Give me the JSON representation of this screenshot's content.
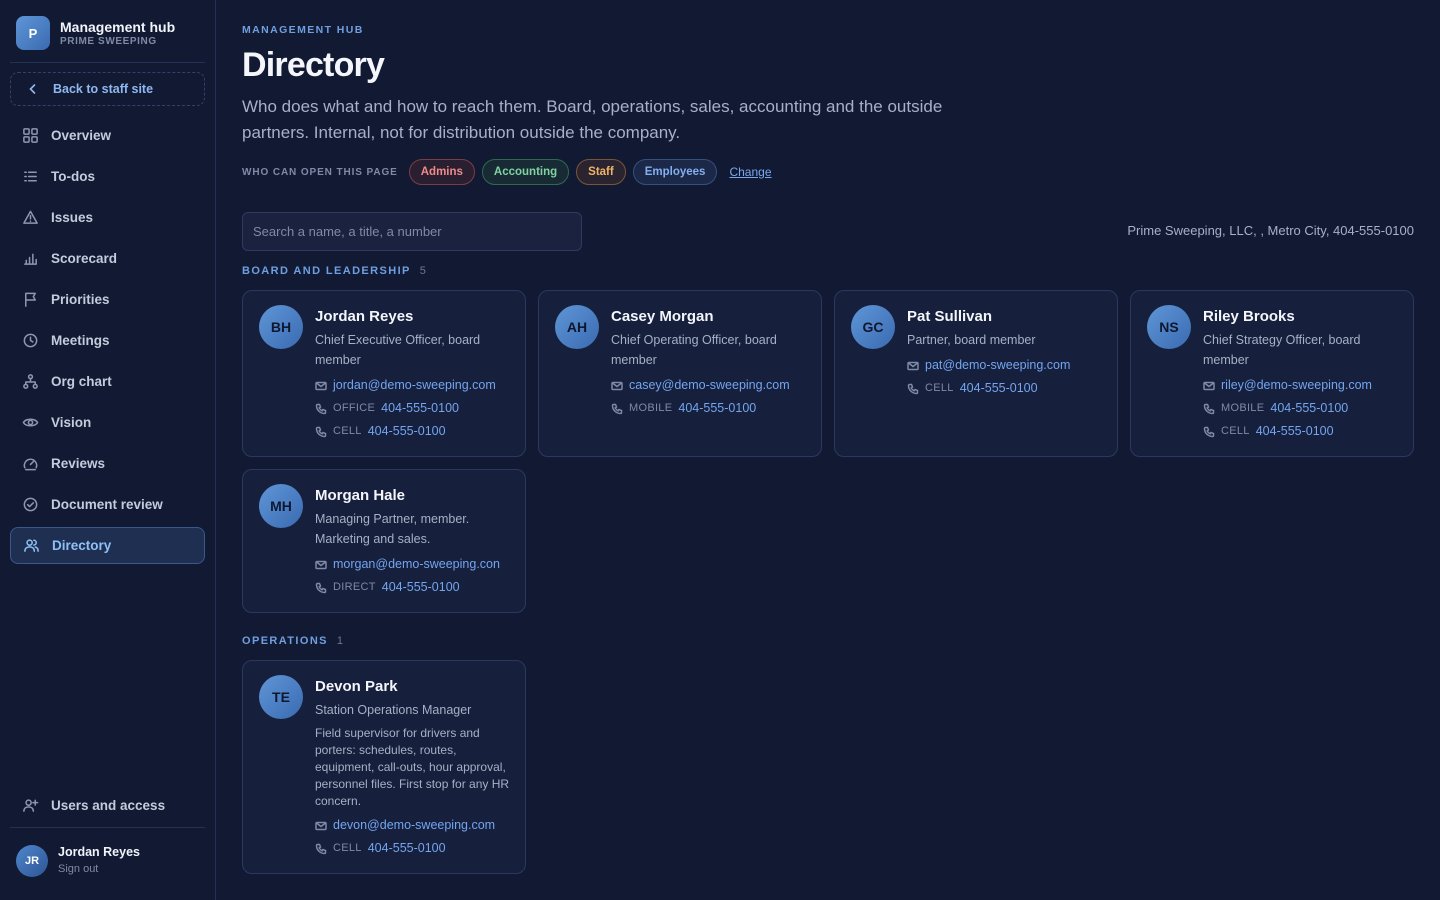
{
  "brand": {
    "logo_letter": "P",
    "title": "Management hub",
    "subtitle": "PRIME SWEEPING"
  },
  "sidebar": {
    "back_label": "Back to staff site",
    "items": [
      {
        "label": "Overview",
        "icon": "grid-icon"
      },
      {
        "label": "To-dos",
        "icon": "list-check-icon"
      },
      {
        "label": "Issues",
        "icon": "warning-icon"
      },
      {
        "label": "Scorecard",
        "icon": "bar-chart-icon"
      },
      {
        "label": "Priorities",
        "icon": "flag-icon"
      },
      {
        "label": "Meetings",
        "icon": "clock-icon"
      },
      {
        "label": "Org chart",
        "icon": "org-chart-icon"
      },
      {
        "label": "Vision",
        "icon": "eye-icon"
      },
      {
        "label": "Reviews",
        "icon": "gauge-icon"
      },
      {
        "label": "Document review",
        "icon": "check-circle-icon"
      },
      {
        "label": "Directory",
        "icon": "users-icon",
        "active": true
      }
    ],
    "users_access_label": "Users and access",
    "user": {
      "initials": "JR",
      "name": "Jordan Reyes",
      "sign_out": "Sign out"
    }
  },
  "header": {
    "eyebrow": "MANAGEMENT HUB",
    "title": "Directory",
    "description": "Who does what and how to reach them. Board, operations, sales, accounting and the outside partners. Internal, not for distribution outside the company."
  },
  "access": {
    "label": "WHO CAN OPEN THIS PAGE",
    "chips": [
      "Admins",
      "Accounting",
      "Staff",
      "Employees"
    ],
    "change_label": "Change"
  },
  "search": {
    "placeholder": "Search a name, a title, a number"
  },
  "company_info": "Prime Sweeping, LLC, , Metro City, 404-555-0100",
  "sections": [
    {
      "title": "BOARD AND LEADERSHIP",
      "count": "5",
      "people": [
        {
          "initials": "BH",
          "name": "Jordan Reyes",
          "role": "Chief Executive Officer, board member",
          "email": "jordan@demo-sweeping.com",
          "phones": [
            {
              "label": "OFFICE",
              "number": "404-555-0100"
            },
            {
              "label": "CELL",
              "number": "404-555-0100"
            }
          ]
        },
        {
          "initials": "AH",
          "name": "Casey Morgan",
          "role": "Chief Operating Officer, board member",
          "email": "casey@demo-sweeping.com",
          "phones": [
            {
              "label": "MOBILE",
              "number": "404-555-0100"
            }
          ]
        },
        {
          "initials": "GC",
          "name": "Pat Sullivan",
          "role": "Partner, board member",
          "email": "pat@demo-sweeping.com",
          "phones": [
            {
              "label": "CELL",
              "number": "404-555-0100"
            }
          ]
        },
        {
          "initials": "NS",
          "name": "Riley Brooks",
          "role": "Chief Strategy Officer, board member",
          "email": "riley@demo-sweeping.com",
          "phones": [
            {
              "label": "MOBILE",
              "number": "404-555-0100"
            },
            {
              "label": "CELL",
              "number": "404-555-0100"
            }
          ]
        },
        {
          "initials": "MH",
          "name": "Morgan Hale",
          "role": "Managing Partner, member. Marketing and sales.",
          "email": "morgan@demo-sweeping.con",
          "phones": [
            {
              "label": "DIRECT",
              "number": "404-555-0100"
            }
          ]
        }
      ]
    },
    {
      "title": "OPERATIONS",
      "count": "1",
      "people": [
        {
          "initials": "TE",
          "name": "Devon Park",
          "role": "Station Operations Manager",
          "blurb": "Field supervisor for drivers and porters: schedules, routes, equipment, call-outs, hour approval, personnel files. First stop for any HR concern.",
          "email": "devon@demo-sweeping.com",
          "phones": [
            {
              "label": "CELL",
              "number": "404-555-0100"
            }
          ]
        }
      ]
    }
  ]
}
